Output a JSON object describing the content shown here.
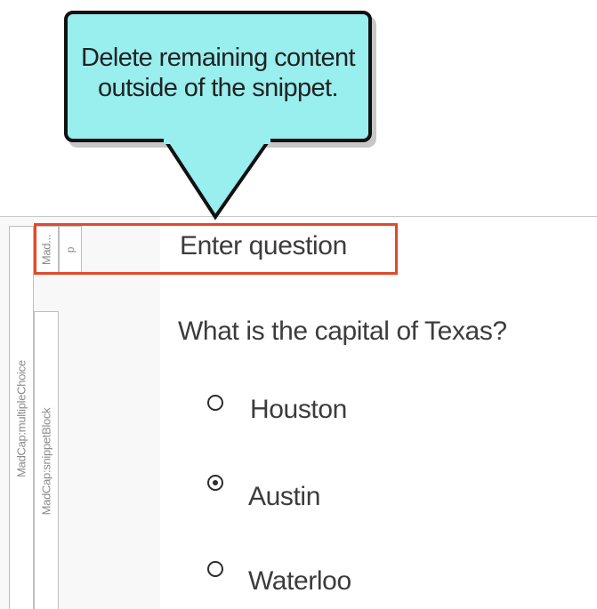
{
  "callout": {
    "text": "Delete remaining content outside of the snippet.",
    "background_color": "#99eeee",
    "border_color": "#111111"
  },
  "structure_bars": {
    "multiple_choice": "MadCap:multipleChoice",
    "snippet_block": "MadCap:snippetBlock",
    "mad_truncated": "Mad...",
    "p": "p"
  },
  "content": {
    "enter_question": "Enter question",
    "question": "What is the capital of Texas?",
    "highlight_color": "#e0492b"
  },
  "options": [
    {
      "label": "Houston",
      "selected": false
    },
    {
      "label": "Austin",
      "selected": true
    },
    {
      "label": "Waterloo",
      "selected": false
    }
  ]
}
